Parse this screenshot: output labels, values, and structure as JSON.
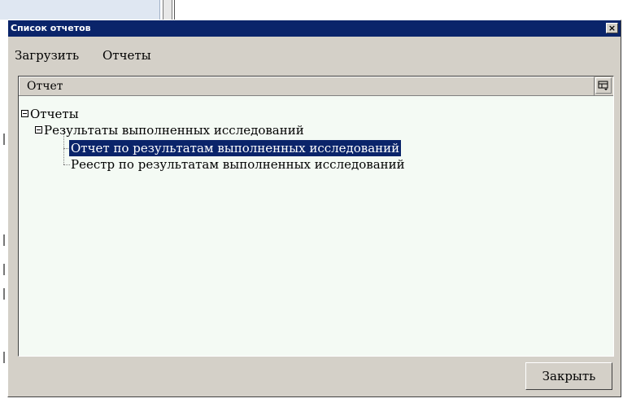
{
  "dialog": {
    "title": "Список отчетов",
    "close_glyph": "×"
  },
  "menu": {
    "items": [
      "Загрузить",
      "Отчеты"
    ]
  },
  "tree": {
    "column_header": "Отчет",
    "nodes": [
      {
        "label": "Отчеты",
        "level": 0,
        "expanded": true,
        "selected": false
      },
      {
        "label": "Результаты выполненных исследований",
        "level": 1,
        "expanded": true,
        "selected": false
      },
      {
        "label": "Отчет по результатам выполненных исследований",
        "level": 2,
        "selected": true
      },
      {
        "label": "Реестр по результатам выполненных исследований",
        "level": 2,
        "selected": false
      }
    ]
  },
  "footer": {
    "close_label": "Закрыть"
  },
  "colors": {
    "titlebar": "#0a246a",
    "selection": "#0a246a",
    "tree_background": "#f4faf4",
    "window_face": "#d4d0c8"
  },
  "icons": {
    "title_close": "close-icon",
    "column_chooser": "column-chooser-icon",
    "expander": "collapse-icon"
  }
}
